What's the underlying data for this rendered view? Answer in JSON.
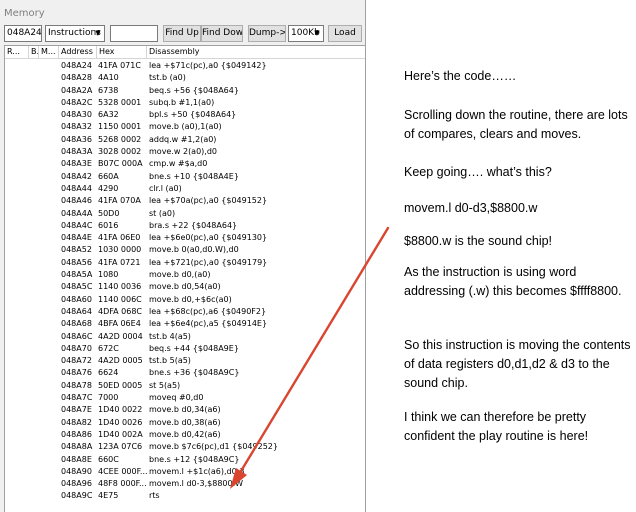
{
  "window": {
    "title": "Memory"
  },
  "toolbar": {
    "address": "048A24",
    "mode": "Instructions",
    "search_value": "",
    "find_up": "Find Up",
    "find_down": "Find Down",
    "dump": "Dump->",
    "size": "100Kb",
    "load": "Load"
  },
  "columns": {
    "r": "R...",
    "b": "B...",
    "m": "M...",
    "address": "Address",
    "hex": "Hex",
    "disassembly": "Disassembly"
  },
  "rows": [
    {
      "addr": "048A24",
      "hex": "41FA 071C",
      "dis": "lea +$71c(pc),a0 {$049142}"
    },
    {
      "addr": "048A28",
      "hex": "4A10",
      "dis": "tst.b (a0)"
    },
    {
      "addr": "048A2A",
      "hex": "6738",
      "dis": "beq.s +56 {$048A64}"
    },
    {
      "addr": "048A2C",
      "hex": "5328 0001",
      "dis": "subq.b #1,1(a0)"
    },
    {
      "addr": "048A30",
      "hex": "6A32",
      "dis": "bpl.s +50 {$048A64}"
    },
    {
      "addr": "048A32",
      "hex": "1150 0001",
      "dis": "move.b (a0),1(a0)"
    },
    {
      "addr": "048A36",
      "hex": "5268 0002",
      "dis": "addq.w #1,2(a0)"
    },
    {
      "addr": "048A3A",
      "hex": "3028 0002",
      "dis": "move.w 2(a0),d0"
    },
    {
      "addr": "048A3E",
      "hex": "B07C 000A",
      "dis": "cmp.w #$a,d0"
    },
    {
      "addr": "048A42",
      "hex": "660A",
      "dis": "bne.s +10 {$048A4E}"
    },
    {
      "addr": "048A44",
      "hex": "4290",
      "dis": "clr.l (a0)"
    },
    {
      "addr": "048A46",
      "hex": "41FA 070A",
      "dis": "lea +$70a(pc),a0 {$049152}"
    },
    {
      "addr": "048A4A",
      "hex": "50D0",
      "dis": "st (a0)"
    },
    {
      "addr": "048A4C",
      "hex": "6016",
      "dis": "bra.s +22 {$048A64}"
    },
    {
      "addr": "048A4E",
      "hex": "41FA 06E0",
      "dis": "lea +$6e0(pc),a0 {$049130}"
    },
    {
      "addr": "048A52",
      "hex": "1030 0000",
      "dis": "move.b 0(a0,d0.W),d0"
    },
    {
      "addr": "048A56",
      "hex": "41FA 0721",
      "dis": "lea +$721(pc),a0 {$049179}"
    },
    {
      "addr": "048A5A",
      "hex": "1080",
      "dis": "move.b d0,(a0)"
    },
    {
      "addr": "048A5C",
      "hex": "1140 0036",
      "dis": "move.b d0,54(a0)"
    },
    {
      "addr": "048A60",
      "hex": "1140 006C",
      "dis": "move.b d0,+$6c(a0)"
    },
    {
      "addr": "048A64",
      "hex": "4DFA 068C",
      "dis": "lea +$68c(pc),a6 {$0490F2}"
    },
    {
      "addr": "048A68",
      "hex": "4BFA 06E4",
      "dis": "lea +$6e4(pc),a5 {$04914E}"
    },
    {
      "addr": "048A6C",
      "hex": "4A2D 0004",
      "dis": "tst.b 4(a5)"
    },
    {
      "addr": "048A70",
      "hex": "672C",
      "dis": "beq.s +44 {$048A9E}"
    },
    {
      "addr": "048A72",
      "hex": "4A2D 0005",
      "dis": "tst.b 5(a5)"
    },
    {
      "addr": "048A76",
      "hex": "6624",
      "dis": "bne.s +36 {$048A9C}"
    },
    {
      "addr": "048A78",
      "hex": "50ED 0005",
      "dis": "st 5(a5)"
    },
    {
      "addr": "048A7C",
      "hex": "7000",
      "dis": "moveq #0,d0"
    },
    {
      "addr": "048A7E",
      "hex": "1D40 0022",
      "dis": "move.b d0,34(a6)"
    },
    {
      "addr": "048A82",
      "hex": "1D40 0026",
      "dis": "move.b d0,38(a6)"
    },
    {
      "addr": "048A86",
      "hex": "1D40 002A",
      "dis": "move.b d0,42(a6)"
    },
    {
      "addr": "048A8A",
      "hex": "123A 07C6",
      "dis": "move.b $7c6(pc),d1 {$049252}"
    },
    {
      "addr": "048A8E",
      "hex": "660C",
      "dis": "bne.s +12 {$048A9C}"
    },
    {
      "addr": "048A90",
      "hex": "4CEE 000F...",
      "dis": "movem.l +$1c(a6),d0-3"
    },
    {
      "addr": "048A96",
      "hex": "48F8 000F...",
      "dis": "movem.l d0-3,$8800.W"
    },
    {
      "addr": "048A9C",
      "hex": "4E75",
      "dis": "rts"
    }
  ],
  "notes": [
    "Here’s the code……",
    "Scrolling down the routine, there are lots of compares, clears and moves.",
    "Keep going…. what’s this?",
    "movem.l d0-d3,$8800.w",
    "$8800.w is the sound chip!",
    "As the instruction is using word addressing (.w) this becomes $ffff8800.",
    "So this instruction is moving the contents of data registers d0,d1,d2 & d3 to the sound chip.",
    "I think we can therefore be pretty confident the play routine is here!"
  ],
  "colors": {
    "arrow": "#d9452f"
  },
  "icons": {
    "dropdown": "chevron-down-icon"
  }
}
